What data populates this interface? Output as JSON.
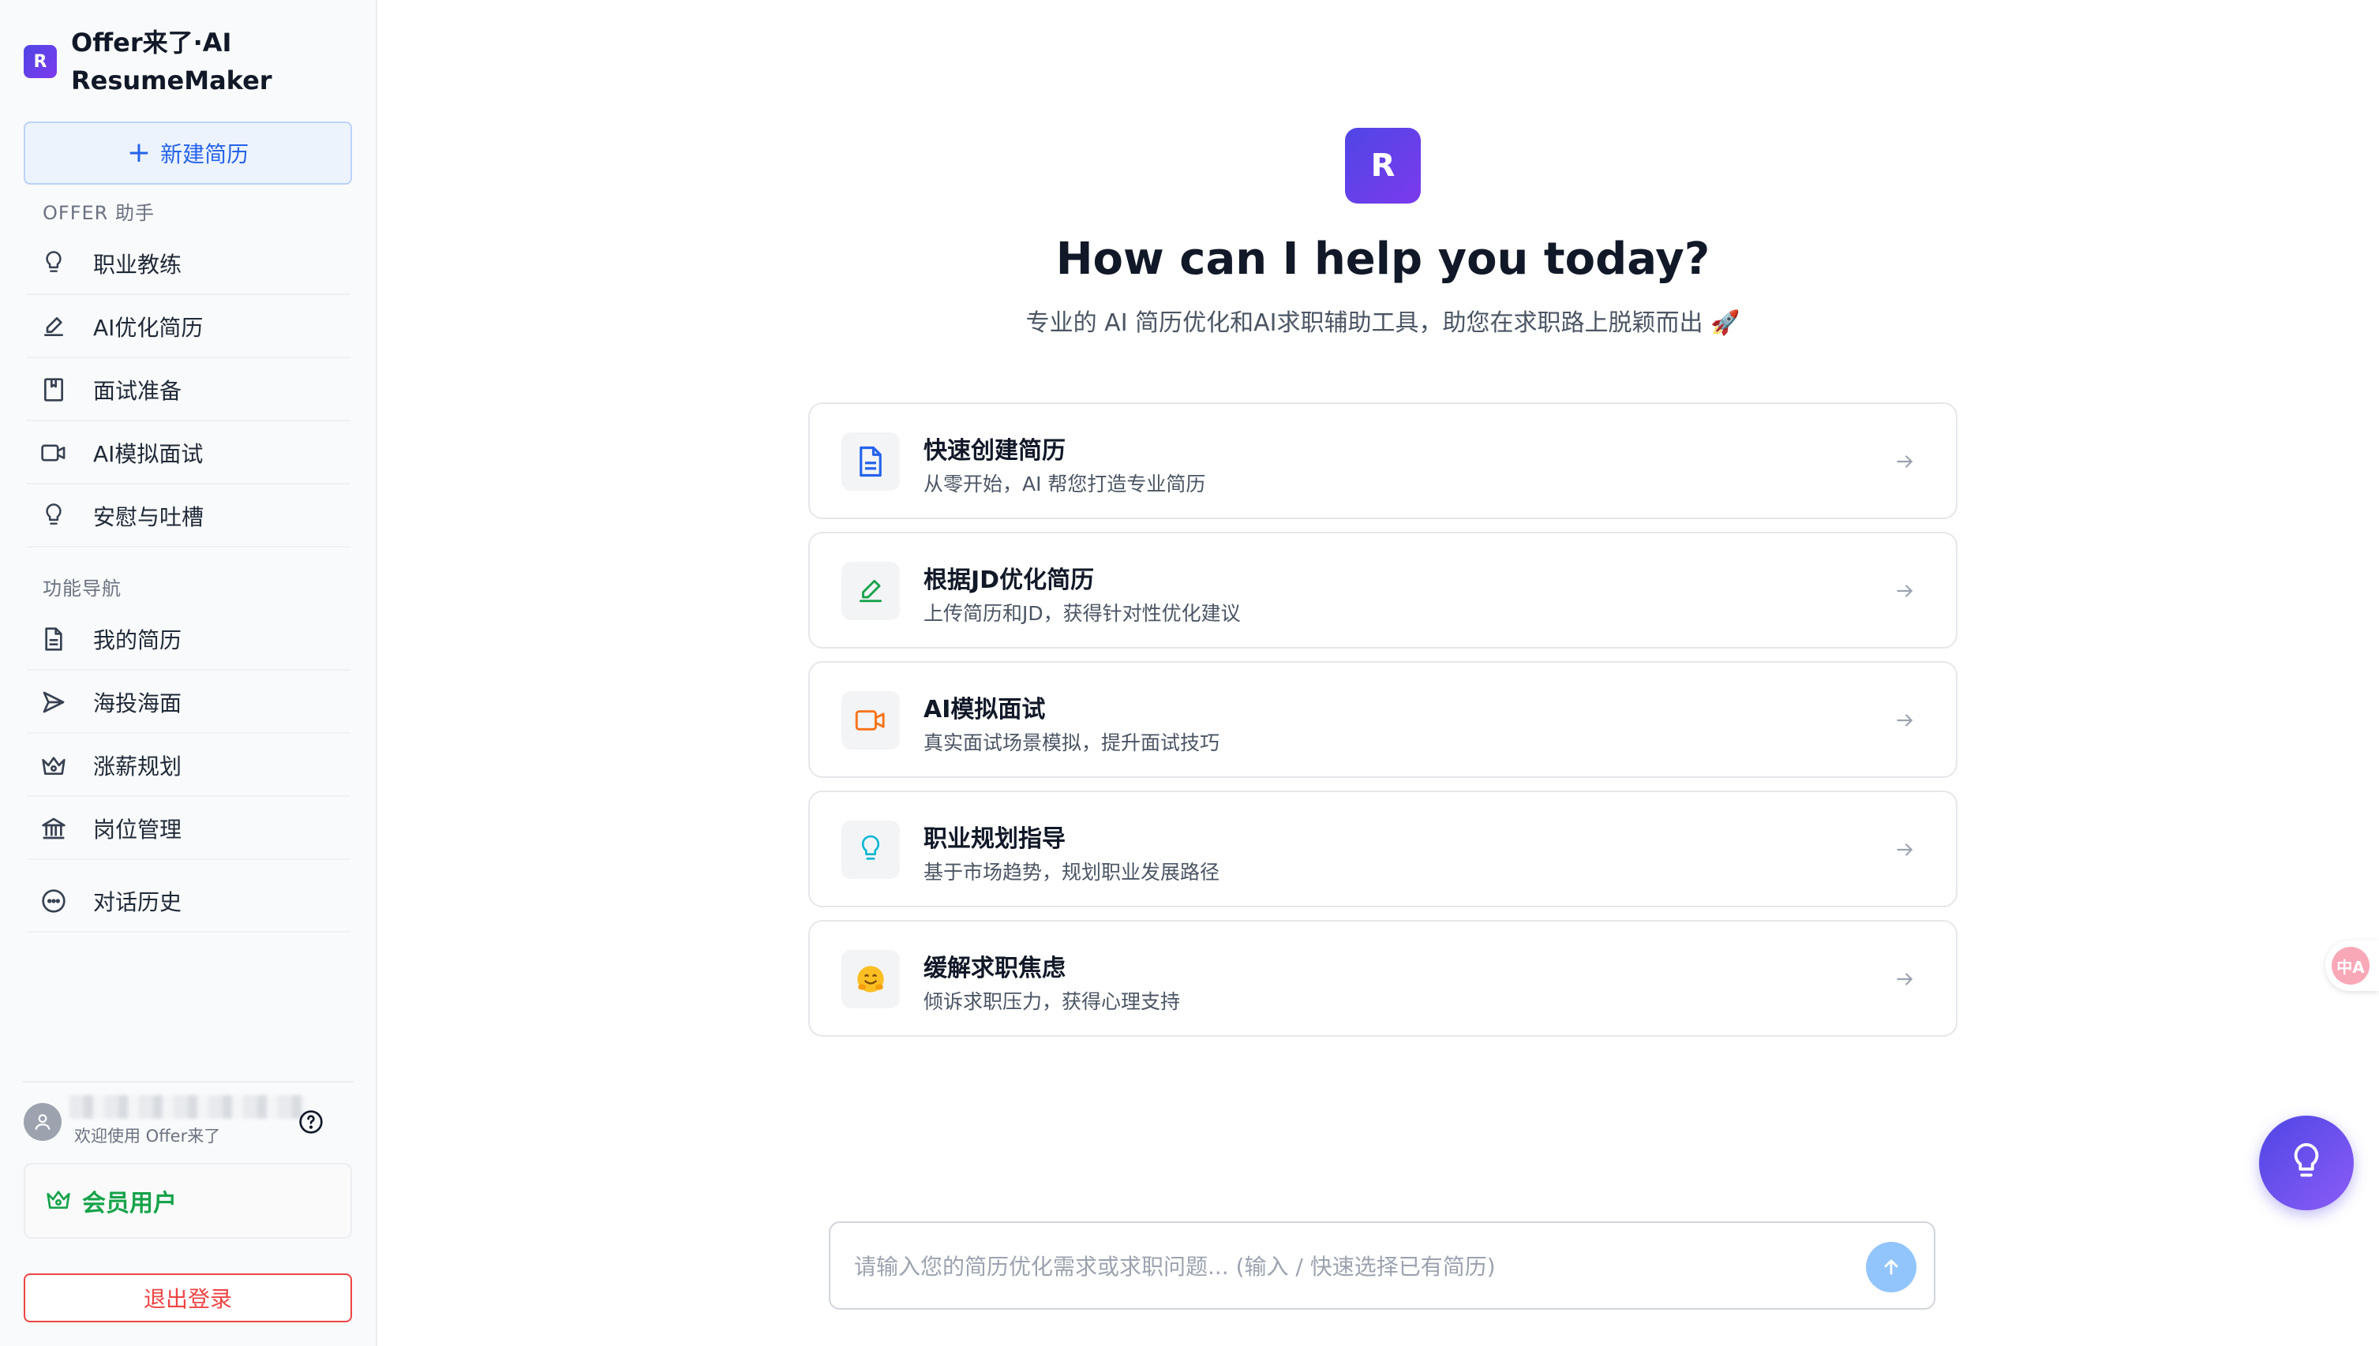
{
  "brand": {
    "logo_letter": "R",
    "name": "Offer来了·AI ResumeMaker"
  },
  "new_resume": {
    "icon": "plus-icon",
    "label": "新建简历"
  },
  "sections": {
    "assistant": "OFFER 助手",
    "navigation": "功能导航"
  },
  "assistant_items": [
    {
      "icon": "lightbulb-icon",
      "label": "职业教练"
    },
    {
      "icon": "pen-icon",
      "label": "AI优化简历"
    },
    {
      "icon": "bookmark-icon",
      "label": "面试准备"
    },
    {
      "icon": "video-icon",
      "label": "AI模拟面试"
    },
    {
      "icon": "lightbulb-icon",
      "label": "安慰与吐槽"
    }
  ],
  "nav_items": [
    {
      "icon": "document-icon",
      "label": "我的简历"
    },
    {
      "icon": "send-icon",
      "label": "海投海面"
    },
    {
      "icon": "crown-icon",
      "label": "涨薪规划"
    },
    {
      "icon": "bank-icon",
      "label": "岗位管理"
    },
    {
      "icon": "chat-icon",
      "label": "对话历史"
    }
  ],
  "user": {
    "welcome": "欢迎使用 Offer来了",
    "help_icon": "question-icon"
  },
  "member": {
    "icon": "crown-icon",
    "label": "会员用户",
    "color": "#16a34a"
  },
  "logout": {
    "label": "退出登录",
    "color": "#ef4444"
  },
  "hero": {
    "logo_letter": "R",
    "title": "How can I help you today?",
    "subtitle": "专业的 AI 简历优化和AI求职辅助工具，助您在求职路上脱颖而出 🚀"
  },
  "cards": [
    {
      "icon": "document-icon",
      "icon_color": "#2563eb",
      "title": "快速创建简历",
      "desc": "从零开始，AI 帮您打造专业简历"
    },
    {
      "icon": "pen-icon",
      "icon_color": "#16a34a",
      "title": "根据JD优化简历",
      "desc": "上传简历和JD，获得针对性优化建议"
    },
    {
      "icon": "video-icon",
      "icon_color": "#f97316",
      "title": "AI模拟面试",
      "desc": "真实面试场景模拟，提升面试技巧"
    },
    {
      "icon": "lightbulb-icon",
      "icon_color": "#06b6d4",
      "title": "职业规划指导",
      "desc": "基于市场趋势，规划职业发展路径"
    },
    {
      "icon": "hug-emoji-icon",
      "icon_color": "#f59e0b",
      "title": "缓解求职焦虑",
      "desc": "倾诉求职压力，获得心理支持"
    }
  ],
  "chat": {
    "placeholder": "请输入您的简历优化需求或求职问题... (输入 / 快速选择已有简历)",
    "send_icon": "arrow-up-icon"
  },
  "fabs": {
    "translate_label": "中A",
    "idea_icon": "lightbulb-icon"
  },
  "colors": {
    "accent": "#2563eb",
    "brand": "#4f46e5",
    "member": "#16a34a",
    "danger": "#ef4444"
  }
}
